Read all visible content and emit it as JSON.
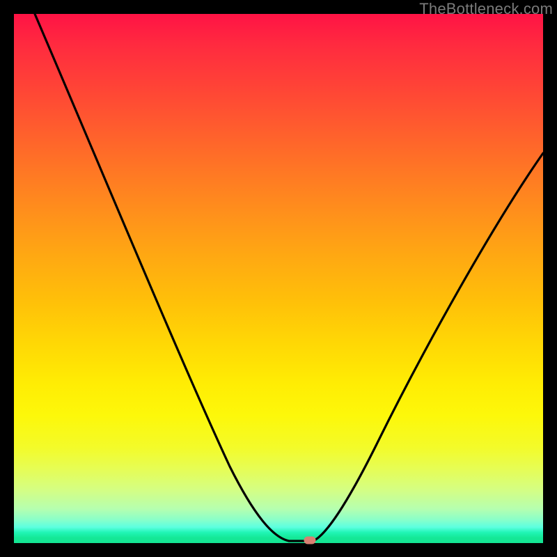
{
  "attribution": "TheBottleneck.com",
  "chart_data": {
    "type": "line",
    "title": "",
    "xlabel": "",
    "ylabel": "",
    "xlim": [
      0,
      100
    ],
    "ylim": [
      0,
      100
    ],
    "x": [
      4,
      10,
      16,
      22,
      28,
      34,
      40,
      44,
      48,
      52,
      55,
      57,
      60,
      66,
      72,
      78,
      84,
      90,
      96,
      100
    ],
    "values": [
      100,
      87,
      74,
      61,
      48,
      36,
      24,
      15,
      8,
      3,
      0.5,
      0.5,
      3,
      12,
      23,
      35,
      47,
      58,
      68,
      74
    ],
    "marker": {
      "x": 56,
      "y": 0
    },
    "gradient_stops": [
      {
        "pos": 0.0,
        "color": "#ff1345"
      },
      {
        "pos": 0.35,
        "color": "#ff8a1d"
      },
      {
        "pos": 0.65,
        "color": "#ffdc05"
      },
      {
        "pos": 0.85,
        "color": "#e6fd55"
      },
      {
        "pos": 1.0,
        "color": "#13e492"
      }
    ]
  }
}
